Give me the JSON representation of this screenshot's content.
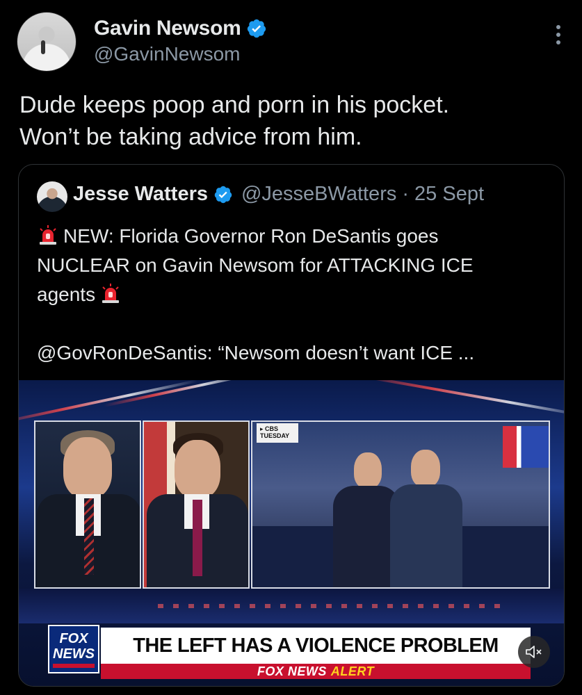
{
  "author": {
    "name": "Gavin Newsom",
    "handle": "@GavinNewsom",
    "verified": true,
    "verified_color": "#1d9bf0"
  },
  "tweet": {
    "text": "Dude keeps poop and porn in his pocket.\nWon’t be taking advice from him."
  },
  "quoted": {
    "name": "Jesse Watters",
    "handle": "@JesseBWatters",
    "separator": "·",
    "date": "25 Sept",
    "lines": [
      "NEW: Florida Governor Ron DeSantis goes",
      "NUCLEAR on Gavin Newsom for ATTACKING ICE",
      "agents",
      "@GovRonDeSantis: “Newsom doesn’t want ICE ..."
    ],
    "icons": [
      "police-siren-icon",
      "police-siren-icon"
    ]
  },
  "video": {
    "cbs_tag_line1": "▸ CBS",
    "cbs_tag_line2": "TUESDAY",
    "logo_line1": "FOX",
    "logo_line2": "NEWS",
    "headline": "THE LEFT HAS A VIOLENCE PROBLEM",
    "alert_prefix": "FOX NEWS",
    "alert_word": "ALERT",
    "mute_icon": "speaker-muted-icon"
  },
  "colors": {
    "background": "#000000",
    "text": "#e7e9ea",
    "secondary_text": "#8b98a5",
    "border": "#2f3336",
    "fox_red": "#c8102e",
    "fox_blue": "#0a2a7a"
  }
}
